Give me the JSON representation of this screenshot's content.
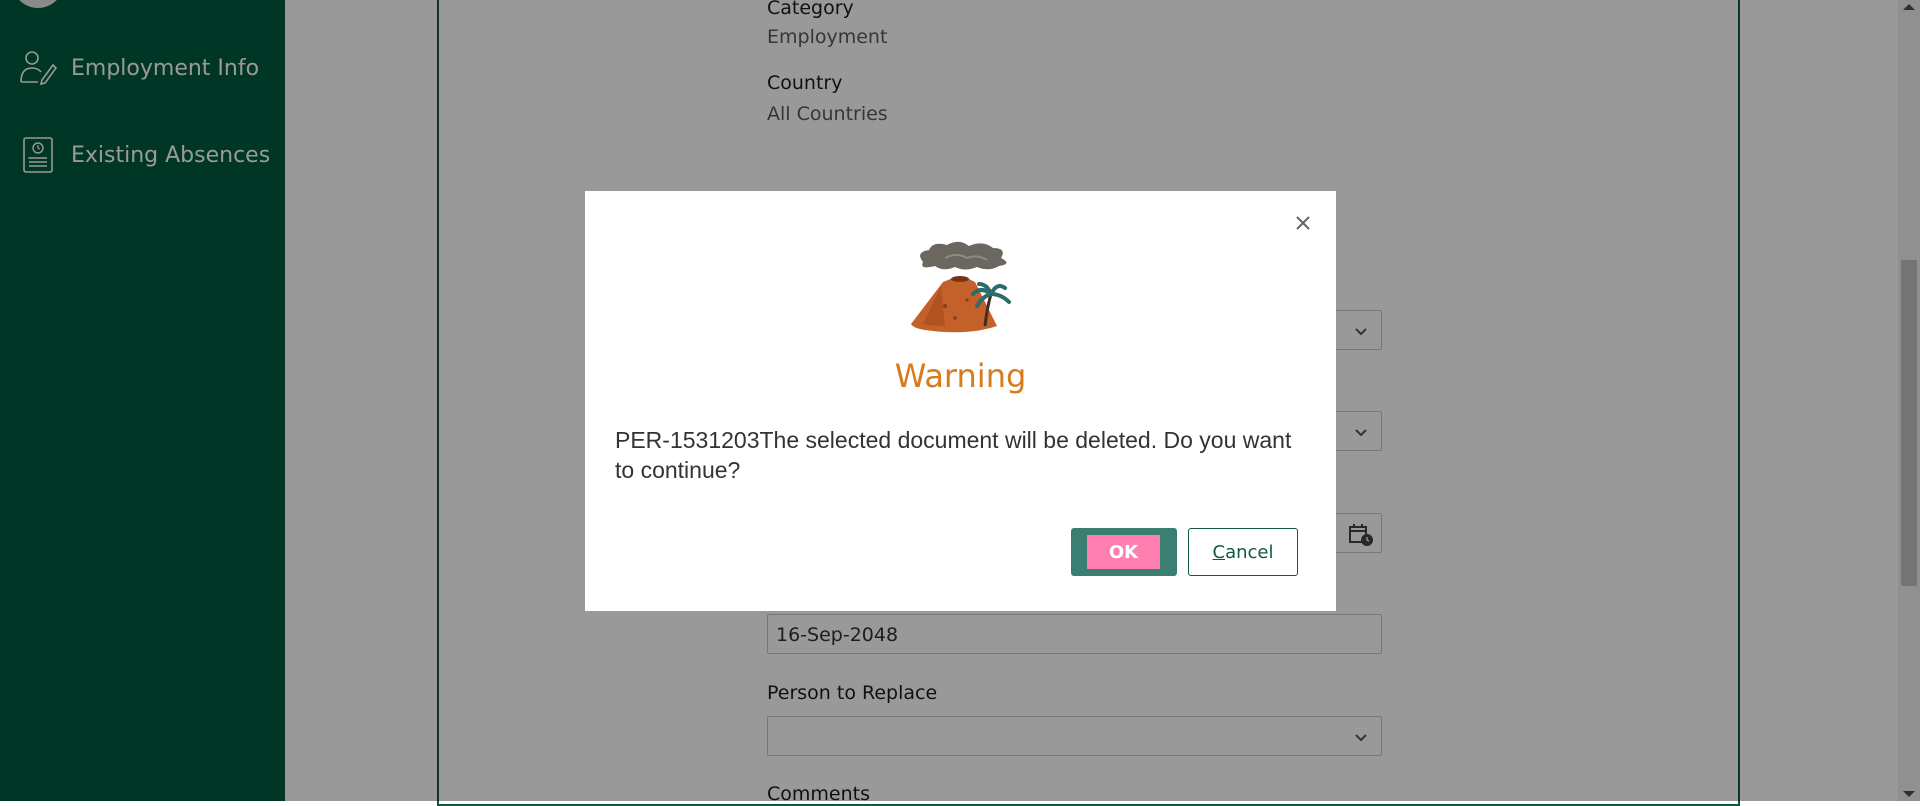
{
  "sidebar": {
    "items": [
      {
        "label": "Employment Info",
        "icon": "person-edit-icon"
      },
      {
        "label": "Existing Absences",
        "icon": "document-clock-icon"
      }
    ]
  },
  "form": {
    "category_label": "Category",
    "category_value": "Employment",
    "country_label": "Country",
    "country_value": "All Countries",
    "date_value": "16-Sep-2048",
    "person_to_replace_label": "Person to Replace",
    "person_to_replace_value": "",
    "comments_label": "Comments"
  },
  "dialog": {
    "title": "Warning",
    "message": "PER-1531203The selected document will be deleted. Do you want to continue?",
    "ok_label": "OK",
    "cancel_underlined_letter": "C",
    "cancel_rest": "ancel",
    "close_icon": "close-icon",
    "illustration": "volcano-icon"
  },
  "colors": {
    "sidebar": "#005a3e",
    "warning_title": "#d87a1e",
    "ok_button": "#3a7f72",
    "ok_inner": "#ff80b0",
    "panel_border": "#0f5a3f"
  }
}
